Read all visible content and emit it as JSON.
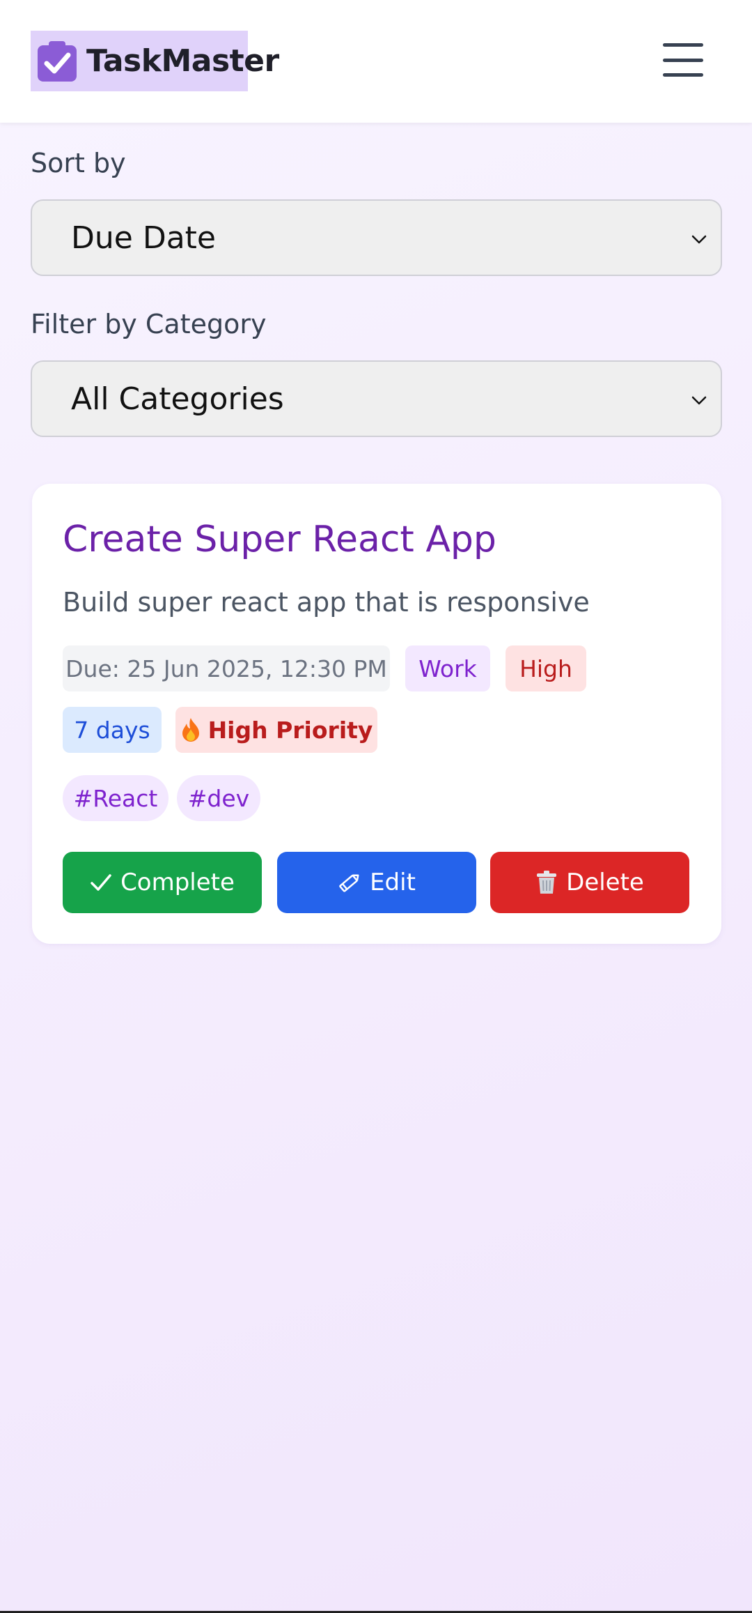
{
  "header": {
    "app_name": "TaskMaster",
    "logo_icon": "clipboard-check-icon",
    "menu_icon": "hamburger-menu-icon",
    "logo_color": "#8b5cd6",
    "logo_bg": "#e0d2fa"
  },
  "sort": {
    "label": "Sort by",
    "selected": "Due Date"
  },
  "filter": {
    "label": "Filter by Category",
    "selected": "All Categories"
  },
  "task": {
    "title": "Create Super React App",
    "description": "Build super react app that is responsive",
    "due": "Due: 25 Jun 2025, 12:30 PM",
    "category": "Work",
    "priority": "High",
    "days_left": "7 days",
    "priority_badge": "High Priority",
    "priority_badge_icon": "fire-icon",
    "tags": [
      "#React",
      "#dev"
    ],
    "actions": {
      "complete": "Complete",
      "edit": "Edit",
      "delete": "Delete"
    },
    "colors": {
      "title": "#6b21a8",
      "complete": "#16a34a",
      "edit": "#2563eb",
      "delete": "#dc2626"
    }
  }
}
